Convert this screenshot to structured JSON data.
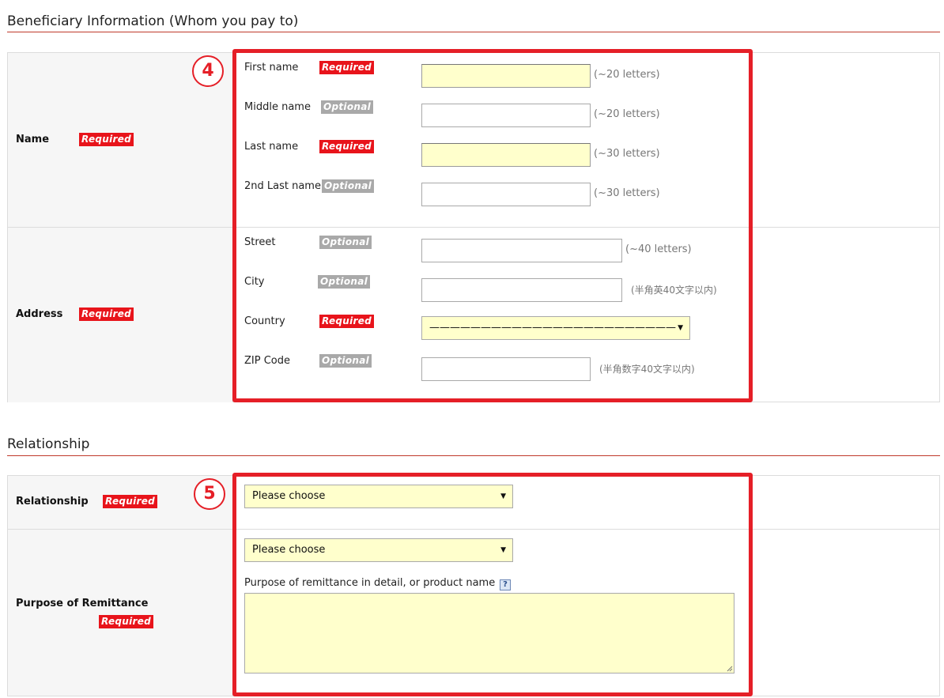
{
  "beneficiary": {
    "section_title": "Beneficiary Information (Whom you pay to)",
    "name_row": {
      "label": "Name",
      "badge": "Required",
      "fields": [
        {
          "label": "First name",
          "badge": "Required",
          "value": "",
          "hint": "(~20 letters)"
        },
        {
          "label": "Middle name",
          "badge": "Optional",
          "value": "",
          "hint": "(~20 letters)"
        },
        {
          "label": "Last name",
          "badge": "Required",
          "value": "",
          "hint": "(~30 letters)"
        },
        {
          "label": "2nd Last name",
          "badge": "Optional",
          "value": "",
          "hint": "(~30 letters)"
        }
      ]
    },
    "address_row": {
      "label": "Address",
      "badge": "Required",
      "fields": [
        {
          "label": "Street",
          "badge": "Optional",
          "value": "",
          "hint": "(~40 letters)"
        },
        {
          "label": "City",
          "badge": "Optional",
          "value": "",
          "hint": "(半角英40文字以内)"
        },
        {
          "label": "Country",
          "badge": "Required",
          "selected": "————————————————————————",
          "arrow": "▼"
        },
        {
          "label": "ZIP Code",
          "badge": "Optional",
          "value": "",
          "hint": "(半角数字40文字以内)"
        }
      ]
    },
    "callout": "4"
  },
  "relationship": {
    "section_title": "Relationship",
    "relationship_row": {
      "label": "Relationship",
      "badge": "Required",
      "selected": "Please choose",
      "arrow": "▼"
    },
    "purpose_row": {
      "label": "Purpose of Remittance",
      "badge": "Required",
      "selected": "Please choose",
      "arrow": "▼",
      "detail_label": "Purpose of remittance in detail, or product name",
      "help_icon": "?",
      "detail_value": ""
    },
    "callout": "5"
  },
  "colors": {
    "required_badge": "#e8141b",
    "optional_badge": "#a9a9a9",
    "highlight_box": "#e51f27",
    "required_field_bg": "#ffffcc",
    "section_rule": "#c0392b"
  }
}
